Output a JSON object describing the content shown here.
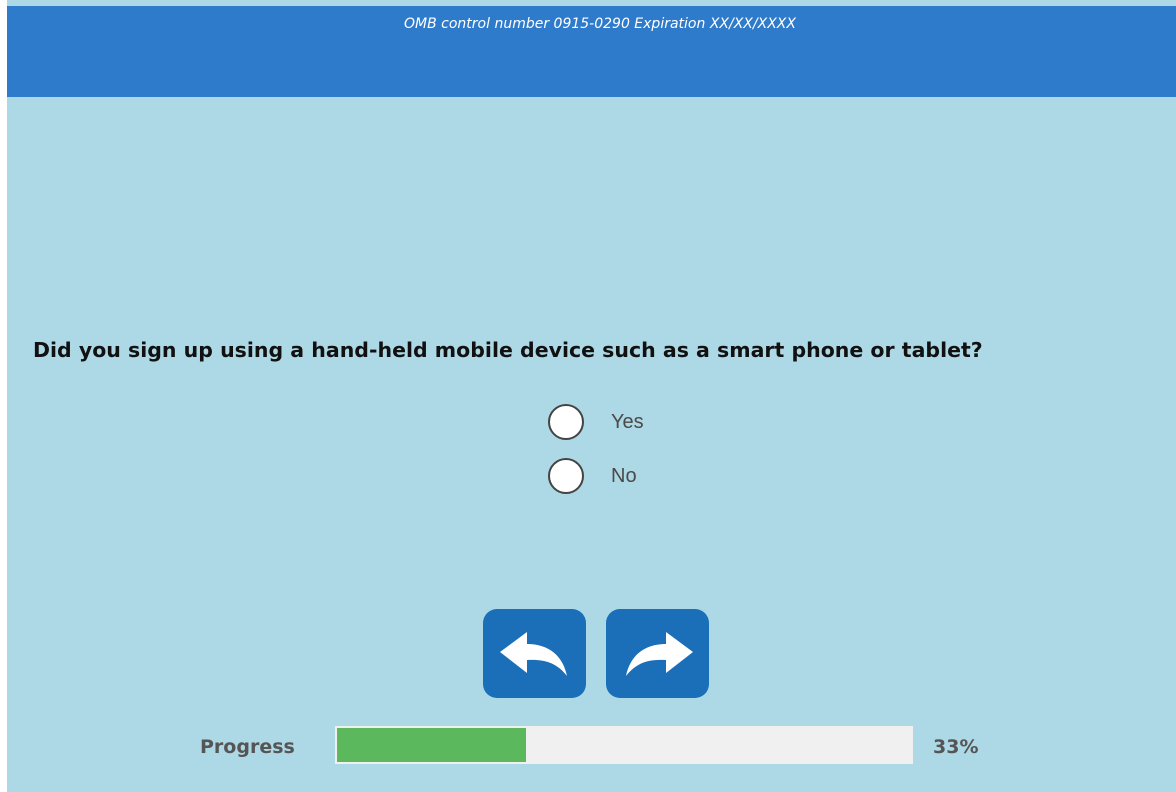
{
  "header": {
    "omb_notice": "OMB control number 0915-0290 Expiration XX/XX/XXXX",
    "color": "#2f7bcb"
  },
  "question": {
    "text": "Did you sign up using a hand-held mobile device such as a smart phone or tablet?",
    "options": [
      {
        "label": "Yes",
        "selected": false
      },
      {
        "label": "No",
        "selected": false
      }
    ]
  },
  "navigation": {
    "back_icon": "back-arrow-icon",
    "next_icon": "forward-arrow-icon",
    "button_color": "#1a6fb8"
  },
  "progress": {
    "label": "Progress",
    "percent_text": "33%",
    "value": 0.33,
    "fill_color": "#5cb85c"
  },
  "colors": {
    "background": "#add8e6"
  }
}
